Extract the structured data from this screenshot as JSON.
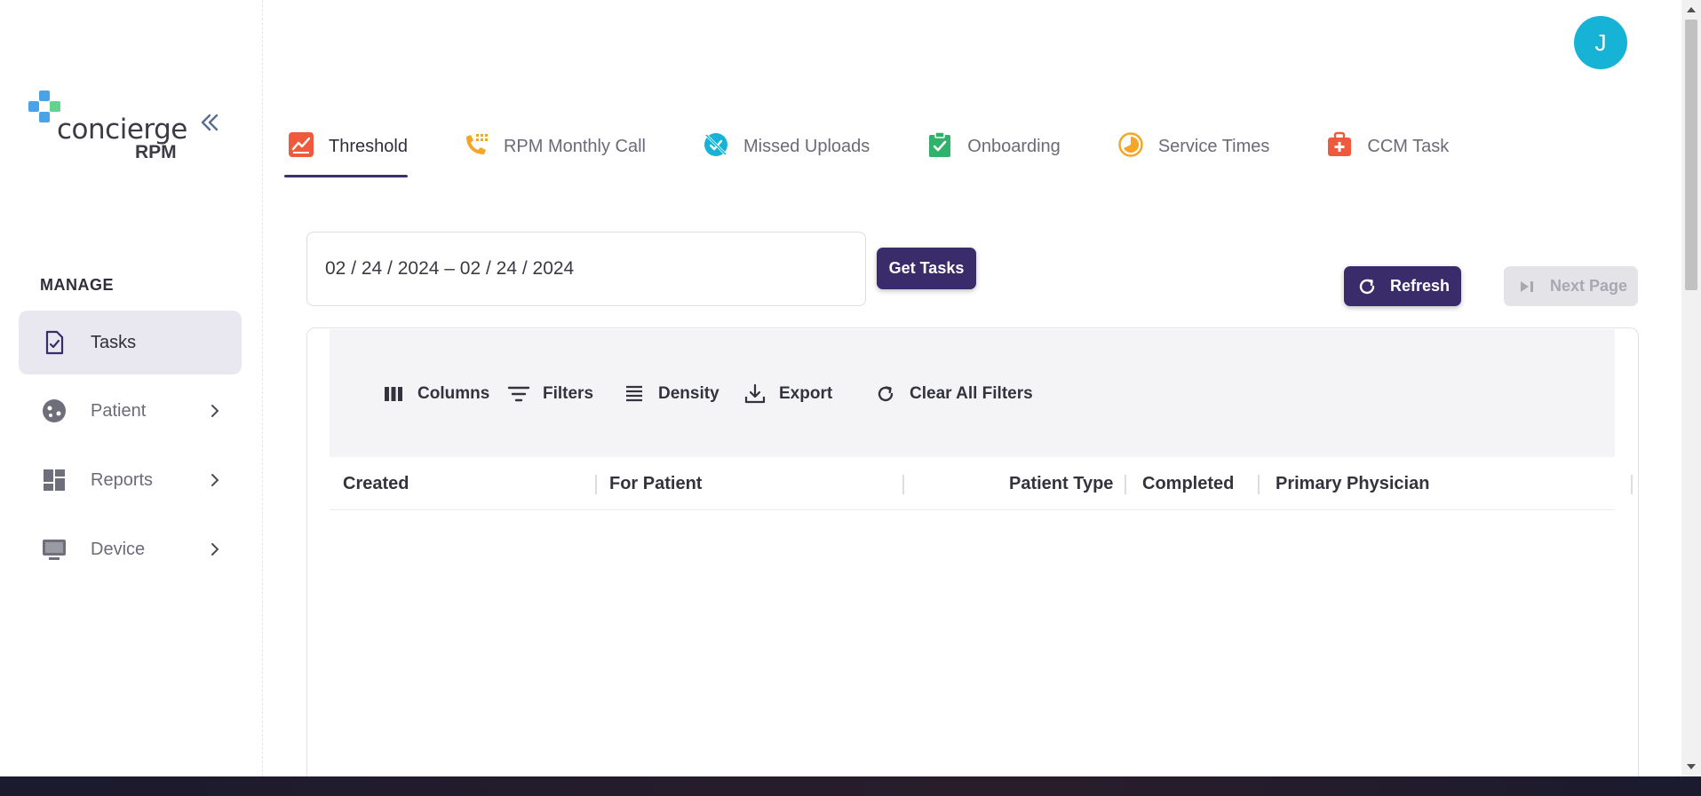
{
  "logo": {
    "word": "concierge",
    "sub": "RPM"
  },
  "user": {
    "initial": "J",
    "color": "#17b3d6"
  },
  "sidebar": {
    "section": "MANAGE",
    "items": [
      {
        "label": "Tasks",
        "icon": "task-document-icon",
        "active": true
      },
      {
        "label": "Patient",
        "icon": "patient-face-icon",
        "has_submenu": true
      },
      {
        "label": "Reports",
        "icon": "dashboard-grid-icon",
        "has_submenu": true
      },
      {
        "label": "Device",
        "icon": "monitor-icon",
        "has_submenu": true
      }
    ]
  },
  "tabs": [
    {
      "label": "Threshold",
      "icon": "threshold-chart-icon",
      "color": "#f05a3c",
      "active": true
    },
    {
      "label": "RPM Monthly Call",
      "icon": "phone-dialpad-icon",
      "color": "#f5a623"
    },
    {
      "label": "Missed Uploads",
      "icon": "missed-upload-icon",
      "color": "#17b3d6"
    },
    {
      "label": "Onboarding",
      "icon": "clipboard-check-icon",
      "color": "#2fb36a"
    },
    {
      "label": "Service Times",
      "icon": "clock-timer-icon",
      "color": "#f5a623"
    },
    {
      "label": "CCM Task",
      "icon": "medical-kit-icon",
      "color": "#f05a3c"
    }
  ],
  "filters": {
    "date_range": "02 / 24 / 2024 – 02 / 24 / 2024",
    "get_tasks_label": "Get Tasks"
  },
  "actions": {
    "refresh_label": "Refresh",
    "next_page_label": "Next Page"
  },
  "grid": {
    "toolbar": {
      "columns_label": "Columns",
      "filters_label": "Filters",
      "density_label": "Density",
      "export_label": "Export",
      "clear_filters_label": "Clear All Filters"
    },
    "columns": [
      "Created",
      "For Patient",
      "Patient Type",
      "Completed",
      "Primary Physician"
    ],
    "rows": []
  },
  "colors": {
    "primary": "#3a2c6b",
    "active_nav_bg": "#e9e7ef"
  }
}
